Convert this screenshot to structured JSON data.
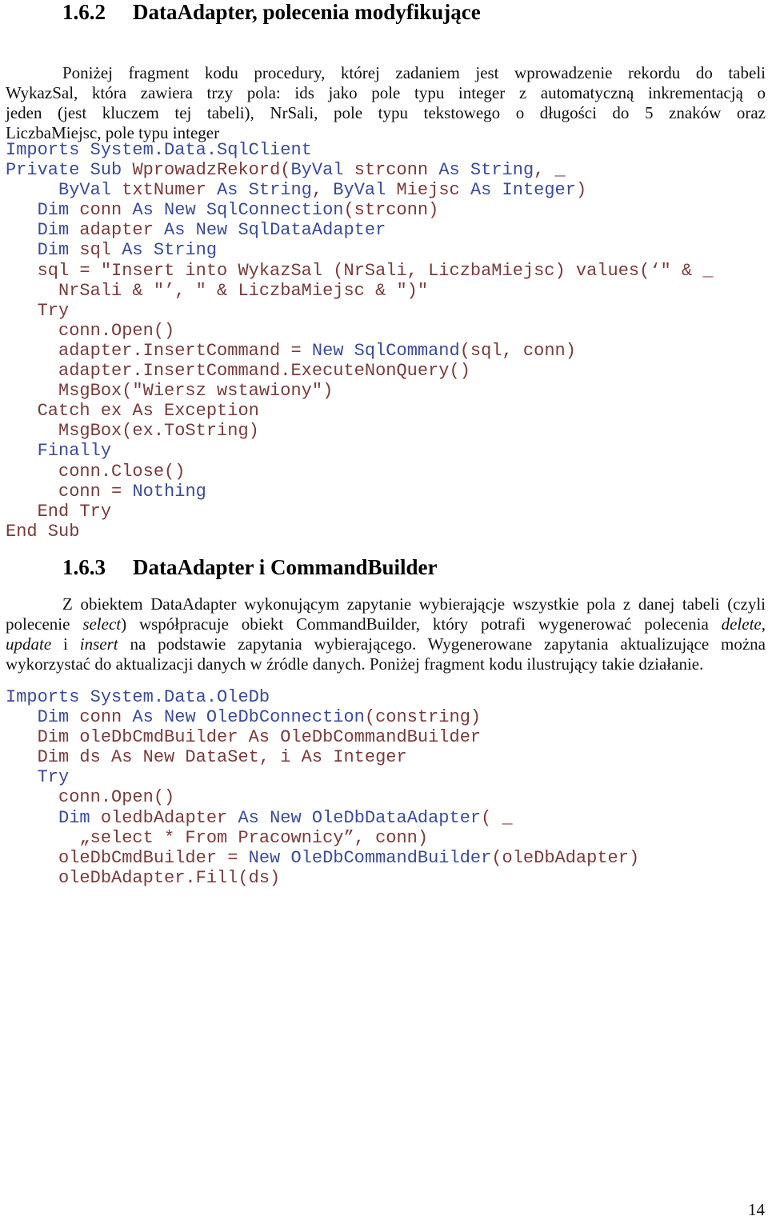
{
  "section1": {
    "number": "1.6.2",
    "title": "DataAdapter, polecenia modyfikujące",
    "paragraph_lines": [
      "Poniżej fragment kodu procedury, której zadaniem jest wprowadzenie rekordu do tabeli",
      "WykazSal, która zawiera trzy pola: ids jako pole typu integer z automatyczną inkrementacją o",
      "jeden (jest kluczem tej tabeli), NrSali, pole typu tekstowego o długości do 5 znaków oraz",
      "LiczbaMiejsc, pole typu integer"
    ],
    "code": [
      [
        {
          "t": "Imports System.Data.SqlClient",
          "c": "kw"
        }
      ],
      [
        {
          "t": "Private Sub ",
          "c": "kw"
        },
        {
          "t": "WprowadzRekord(",
          "c": "id"
        },
        {
          "t": "ByVal ",
          "c": "kw"
        },
        {
          "t": "strconn ",
          "c": "id"
        },
        {
          "t": "As String",
          "c": "kw"
        },
        {
          "t": ", _",
          "c": "id"
        }
      ],
      [
        {
          "t": "     ByVal ",
          "c": "kw"
        },
        {
          "t": "txtNumer ",
          "c": "id"
        },
        {
          "t": "As String",
          "c": "kw"
        },
        {
          "t": ", ",
          "c": "id"
        },
        {
          "t": "ByVal ",
          "c": "kw"
        },
        {
          "t": "Miejsc ",
          "c": "id"
        },
        {
          "t": "As Integer",
          "c": "kw"
        },
        {
          "t": ")",
          "c": "id"
        }
      ],
      [
        {
          "t": "   Dim ",
          "c": "kw"
        },
        {
          "t": "conn ",
          "c": "id"
        },
        {
          "t": "As New SqlConnection",
          "c": "kw"
        },
        {
          "t": "(strconn)",
          "c": "id"
        }
      ],
      [
        {
          "t": "   Dim ",
          "c": "kw"
        },
        {
          "t": "adapter ",
          "c": "id"
        },
        {
          "t": "As New SqlDataAdapter",
          "c": "kw"
        }
      ],
      [
        {
          "t": "   Dim ",
          "c": "kw"
        },
        {
          "t": "sql ",
          "c": "id"
        },
        {
          "t": "As String",
          "c": "kw"
        }
      ],
      [
        {
          "t": "   sql = \"Insert into WykazSal (NrSali, LiczbaMiejsc) values(‘\" & _",
          "c": "id"
        }
      ],
      [
        {
          "t": "     NrSali & \"’, \" & LiczbaMiejsc & \")\"",
          "c": "id"
        }
      ],
      [
        {
          "t": "   Try",
          "c": "id"
        }
      ],
      [
        {
          "t": "     conn.Open()",
          "c": "id"
        }
      ],
      [
        {
          "t": "     adapter.InsertCommand = ",
          "c": "id"
        },
        {
          "t": "New SqlCommand",
          "c": "kw"
        },
        {
          "t": "(sql, conn)",
          "c": "id"
        }
      ],
      [
        {
          "t": "     adapter.InsertCommand.ExecuteNonQuery()",
          "c": "id"
        }
      ],
      [
        {
          "t": "     MsgBox(\"Wiersz wstawiony\")",
          "c": "id"
        }
      ],
      [
        {
          "t": "   Catch ex As Exception",
          "c": "id"
        }
      ],
      [
        {
          "t": "     MsgBox(ex.ToString)",
          "c": "id"
        }
      ],
      [
        {
          "t": "   Finally",
          "c": "kw"
        }
      ],
      [
        {
          "t": "     conn.Close()",
          "c": "id"
        }
      ],
      [
        {
          "t": "     conn = ",
          "c": "id"
        },
        {
          "t": "Nothing",
          "c": "kw"
        }
      ],
      [
        {
          "t": "   End Try",
          "c": "id"
        }
      ],
      [
        {
          "t": "End Sub",
          "c": "id"
        }
      ]
    ]
  },
  "section2": {
    "number": "1.6.3",
    "title": "DataAdapter i CommandBuilder",
    "paragraph_lines": [
      [
        {
          "t": "Z obiektem DataAdapter wykonującym zapytanie wybierającje wszystkie pola z danej tabeli (czyli",
          "i": false
        }
      ],
      [
        {
          "t": "polecenie ",
          "i": false
        },
        {
          "t": "select",
          "i": true
        },
        {
          "t": ") współpracuje obiekt CommandBuilder, który potrafi wygenerować polecenia ",
          "i": false
        },
        {
          "t": "delete",
          "i": true
        },
        {
          "t": ",",
          "i": false
        }
      ],
      [
        {
          "t": "update",
          "i": true
        },
        {
          "t": " i ",
          "i": false
        },
        {
          "t": "insert",
          "i": true
        },
        {
          "t": " na podstawie zapytania wybierającego. Wygenerowane zapytania aktualizujące można",
          "i": false
        }
      ],
      [
        {
          "t": "wykorzystać do aktualizacji danych w źródle danych. Poniżej fragment kodu ilustrujący takie działanie.",
          "i": false
        }
      ]
    ],
    "code": [
      [
        {
          "t": "Imports System.Data.OleDb",
          "c": "kw"
        }
      ],
      [
        {
          "t": "   Dim ",
          "c": "kw"
        },
        {
          "t": "conn ",
          "c": "id"
        },
        {
          "t": "As New OleDbConnection",
          "c": "kw"
        },
        {
          "t": "(constring)",
          "c": "id"
        }
      ],
      [
        {
          "t": "   Dim oleDbCmdBuilder As OleDbCommandBuilder",
          "c": "id"
        }
      ],
      [
        {
          "t": "   Dim ds As New DataSet, i As Integer",
          "c": "id"
        }
      ],
      [
        {
          "t": "   Try",
          "c": "kw"
        }
      ],
      [
        {
          "t": "     conn.Open()",
          "c": "id"
        }
      ],
      [
        {
          "t": "     Dim ",
          "c": "kw"
        },
        {
          "t": "oledbAdapter ",
          "c": "id"
        },
        {
          "t": "As New OleDbDataAdapter",
          "c": "kw"
        },
        {
          "t": "( _",
          "c": "id"
        }
      ],
      [
        {
          "t": "       „select * From Pracownicy”, conn)",
          "c": "id"
        }
      ],
      [
        {
          "t": "     oleDbCmdBuilder = ",
          "c": "id"
        },
        {
          "t": "New OleDbCommandBuilder",
          "c": "kw"
        },
        {
          "t": "(oleDbAdapter)",
          "c": "id"
        }
      ],
      [
        {
          "t": "     oleDbAdapter.Fill(ds)",
          "c": "id"
        }
      ]
    ]
  },
  "page_number": "14",
  "colors": {
    "keyword": "#3a4a9e",
    "identifier": "#7a3a3a",
    "text": "#111111"
  }
}
